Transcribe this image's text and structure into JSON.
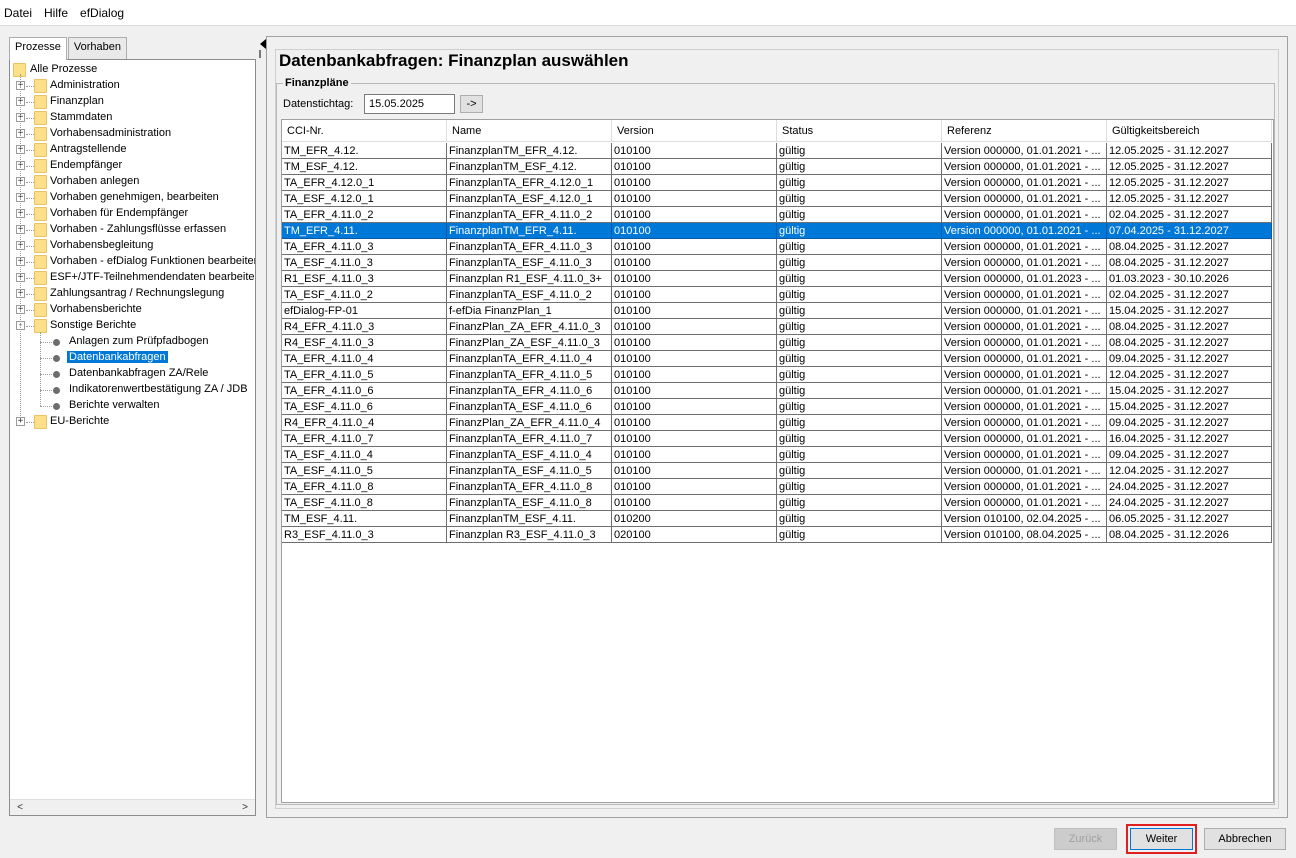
{
  "menu": {
    "items": [
      {
        "label": "Datei"
      },
      {
        "label": "Hilfe"
      },
      {
        "label": "efDialog"
      }
    ]
  },
  "left": {
    "tabs": [
      "Prozesse",
      "Vorhaben"
    ],
    "tree": [
      {
        "label": "Alle Prozesse",
        "level": 0,
        "type": "folder",
        "expander": ""
      },
      {
        "label": "Administration",
        "level": 1,
        "type": "folder",
        "expander": "+"
      },
      {
        "label": "Finanzplan",
        "level": 1,
        "type": "folder",
        "expander": "+"
      },
      {
        "label": "Stammdaten",
        "level": 1,
        "type": "folder",
        "expander": "+"
      },
      {
        "label": "Vorhabensadministration",
        "level": 1,
        "type": "folder",
        "expander": "+"
      },
      {
        "label": "Antragstellende",
        "level": 1,
        "type": "folder",
        "expander": "+"
      },
      {
        "label": "Endempfänger",
        "level": 1,
        "type": "folder",
        "expander": "+"
      },
      {
        "label": "Vorhaben anlegen",
        "level": 1,
        "type": "folder",
        "expander": "+"
      },
      {
        "label": "Vorhaben genehmigen, bearbeiten",
        "level": 1,
        "type": "folder",
        "expander": "+"
      },
      {
        "label": "Vorhaben für Endempfänger",
        "level": 1,
        "type": "folder",
        "expander": "+"
      },
      {
        "label": "Vorhaben - Zahlungsflüsse erfassen",
        "level": 1,
        "type": "folder",
        "expander": "+"
      },
      {
        "label": "Vorhabensbegleitung",
        "level": 1,
        "type": "folder",
        "expander": "+"
      },
      {
        "label": "Vorhaben - efDialog Funktionen bearbeiten",
        "level": 1,
        "type": "folder",
        "expander": "+"
      },
      {
        "label": "ESF+/JTF-Teilnehmendendaten bearbeiten",
        "level": 1,
        "type": "folder",
        "expander": "+"
      },
      {
        "label": "Zahlungsantrag / Rechnungslegung",
        "level": 1,
        "type": "folder",
        "expander": "+"
      },
      {
        "label": "Vorhabensberichte",
        "level": 1,
        "type": "folder",
        "expander": "+"
      },
      {
        "label": "Sonstige Berichte",
        "level": 1,
        "type": "folder",
        "expander": "-"
      },
      {
        "label": "Anlagen zum Prüfpfadbogen",
        "level": 2,
        "type": "leaf",
        "expander": ""
      },
      {
        "label": "Datenbankabfragen",
        "level": 2,
        "type": "leaf",
        "expander": "",
        "selected": true
      },
      {
        "label": "Datenbankabfragen ZA/Rele",
        "level": 2,
        "type": "leaf",
        "expander": ""
      },
      {
        "label": "Indikatorenwertbestätigung ZA / JDB",
        "level": 2,
        "type": "leaf",
        "expander": ""
      },
      {
        "label": "Berichte verwalten",
        "level": 2,
        "type": "leaf",
        "expander": ""
      },
      {
        "label": "EU-Berichte",
        "level": 1,
        "type": "folder",
        "expander": "+"
      }
    ],
    "scroll_left": "<",
    "scroll_right": ">"
  },
  "main": {
    "title": "Datenbankabfragen: Finanzplan auswählen",
    "group_title": "Finanzpläne",
    "stichtag_label": "Datenstichtag:",
    "stichtag_value": "15.05.2025",
    "go_label": "->",
    "columns": [
      "CCI-Nr.",
      "Name",
      "Version",
      "Status",
      "Referenz",
      "Gültigkeitsbereich"
    ],
    "rows": [
      [
        "TM_EFR_4.12.",
        "FinanzplanTM_EFR_4.12.",
        "010100",
        "gültig",
        "Version 000000,  01.01.2021 - ...",
        "12.05.2025 - 31.12.2027"
      ],
      [
        "TM_ESF_4.12.",
        "FinanzplanTM_ESF_4.12.",
        "010100",
        "gültig",
        "Version 000000,  01.01.2021 - ...",
        "12.05.2025 - 31.12.2027"
      ],
      [
        "TA_EFR_4.12.0_1",
        "FinanzplanTA_EFR_4.12.0_1",
        "010100",
        "gültig",
        "Version 000000,  01.01.2021 - ...",
        "12.05.2025 - 31.12.2027"
      ],
      [
        "TA_ESF_4.12.0_1",
        "FinanzplanTA_ESF_4.12.0_1",
        "010100",
        "gültig",
        "Version 000000,  01.01.2021 - ...",
        "12.05.2025 - 31.12.2027"
      ],
      [
        "TA_EFR_4.11.0_2",
        "FinanzplanTA_EFR_4.11.0_2",
        "010100",
        "gültig",
        "Version 000000,  01.01.2021 - ...",
        "02.04.2025 - 31.12.2027"
      ],
      [
        "TM_EFR_4.11.",
        "FinanzplanTM_EFR_4.11.",
        "010100",
        "gültig",
        "Version 000000,  01.01.2021 - ...",
        "07.04.2025 - 31.12.2027"
      ],
      [
        "TA_EFR_4.11.0_3",
        "FinanzplanTA_EFR_4.11.0_3",
        "010100",
        "gültig",
        "Version 000000,  01.01.2021 - ...",
        "08.04.2025 - 31.12.2027"
      ],
      [
        "TA_ESF_4.11.0_3",
        "FinanzplanTA_ESF_4.11.0_3",
        "010100",
        "gültig",
        "Version 000000,  01.01.2021 - ...",
        "08.04.2025 - 31.12.2027"
      ],
      [
        "R1_ESF_4.11.0_3",
        "Finanzplan R1_ESF_4.11.0_3+",
        "010100",
        "gültig",
        "Version 000000,  01.01.2023 - ...",
        "01.03.2023 - 30.10.2026"
      ],
      [
        "TA_ESF_4.11.0_2",
        "FinanzplanTA_ESF_4.11.0_2",
        "010100",
        "gültig",
        "Version 000000,  01.01.2021 - ...",
        "02.04.2025 - 31.12.2027"
      ],
      [
        "efDialog-FP-01",
        "f-efDia FinanzPlan_1",
        "010100",
        "gültig",
        "Version 000000,  01.01.2021 - ...",
        "15.04.2025 - 31.12.2027"
      ],
      [
        "R4_EFR_4.11.0_3",
        "FinanzPlan_ZA_EFR_4.11.0_3",
        "010100",
        "gültig",
        "Version 000000,  01.01.2021 - ...",
        "08.04.2025 - 31.12.2027"
      ],
      [
        "R4_ESF_4.11.0_3",
        "FinanzPlan_ZA_ESF_4.11.0_3",
        "010100",
        "gültig",
        "Version 000000,  01.01.2021 - ...",
        "08.04.2025 - 31.12.2027"
      ],
      [
        "TA_EFR_4.11.0_4",
        "FinanzplanTA_EFR_4.11.0_4",
        "010100",
        "gültig",
        "Version 000000,  01.01.2021 - ...",
        "09.04.2025 - 31.12.2027"
      ],
      [
        "TA_EFR_4.11.0_5",
        "FinanzplanTA_EFR_4.11.0_5",
        "010100",
        "gültig",
        "Version 000000,  01.01.2021 - ...",
        "12.04.2025 - 31.12.2027"
      ],
      [
        "TA_EFR_4.11.0_6",
        "FinanzplanTA_EFR_4.11.0_6",
        "010100",
        "gültig",
        "Version 000000,  01.01.2021 - ...",
        "15.04.2025 - 31.12.2027"
      ],
      [
        "TA_ESF_4.11.0_6",
        "FinanzplanTA_ESF_4.11.0_6",
        "010100",
        "gültig",
        "Version 000000,  01.01.2021 - ...",
        "15.04.2025 - 31.12.2027"
      ],
      [
        "R4_EFR_4.11.0_4",
        "FinanzPlan_ZA_EFR_4.11.0_4",
        "010100",
        "gültig",
        "Version 000000,  01.01.2021 - ...",
        "09.04.2025 - 31.12.2027"
      ],
      [
        "TA_EFR_4.11.0_7",
        "FinanzplanTA_EFR_4.11.0_7",
        "010100",
        "gültig",
        "Version 000000,  01.01.2021 - ...",
        "16.04.2025 - 31.12.2027"
      ],
      [
        "TA_ESF_4.11.0_4",
        "FinanzplanTA_ESF_4.11.0_4",
        "010100",
        "gültig",
        "Version 000000,  01.01.2021 - ...",
        "09.04.2025 - 31.12.2027"
      ],
      [
        "TA_ESF_4.11.0_5",
        "FinanzplanTA_ESF_4.11.0_5",
        "010100",
        "gültig",
        "Version 000000,  01.01.2021 - ...",
        "12.04.2025 - 31.12.2027"
      ],
      [
        "TA_EFR_4.11.0_8",
        "FinanzplanTA_EFR_4.11.0_8",
        "010100",
        "gültig",
        "Version 000000,  01.01.2021 - ...",
        "24.04.2025 - 31.12.2027"
      ],
      [
        "TA_ESF_4.11.0_8",
        "FinanzplanTA_ESF_4.11.0_8",
        "010100",
        "gültig",
        "Version 000000,  01.01.2021 - ...",
        "24.04.2025 - 31.12.2027"
      ],
      [
        "TM_ESF_4.11.",
        "FinanzplanTM_ESF_4.11.",
        "010200",
        "gültig",
        "Version 010100,  02.04.2025 - ...",
        "06.05.2025 - 31.12.2027"
      ],
      [
        "R3_ESF_4.11.0_3",
        "Finanzplan R3_ESF_4.11.0_3",
        "020100",
        "gültig",
        "Version 010100,  08.04.2025 - ...",
        "08.04.2025 - 31.12.2026"
      ]
    ],
    "selected_row": 5
  },
  "buttons": {
    "back": "Zurück",
    "next": "Weiter",
    "cancel": "Abbrechen"
  },
  "colors": {
    "selection": "#0078d7",
    "highlight_outline": "#e02020",
    "folder": "#ffe08a"
  }
}
